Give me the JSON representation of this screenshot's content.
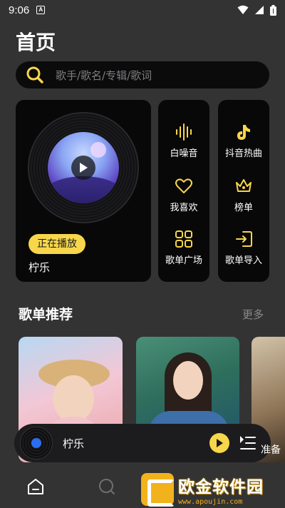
{
  "status_bar": {
    "time": "9:06",
    "notification_badge": "A"
  },
  "header": {
    "title": "首页"
  },
  "search": {
    "placeholder": "歌手/歌名/专辑/歌词"
  },
  "now_playing": {
    "badge": "正在播放",
    "title": "柠乐"
  },
  "quick_tiles": {
    "white_noise": "白噪音",
    "douyin_hot": "抖音热曲",
    "favorites": "我喜欢",
    "charts": "榜单",
    "playlist_square": "歌单广场",
    "playlist_import": "歌单导入"
  },
  "recommend": {
    "title": "歌单推荐",
    "more": "更多"
  },
  "mini_player": {
    "title": "柠乐",
    "overlap_text": "准备"
  },
  "watermark": {
    "main": "欧金软件园",
    "url": "www.apoujin.com"
  },
  "colors": {
    "accent": "#f7d64b",
    "background": "#333334",
    "card": "#080808",
    "mini_player": "#1c1c1e"
  }
}
